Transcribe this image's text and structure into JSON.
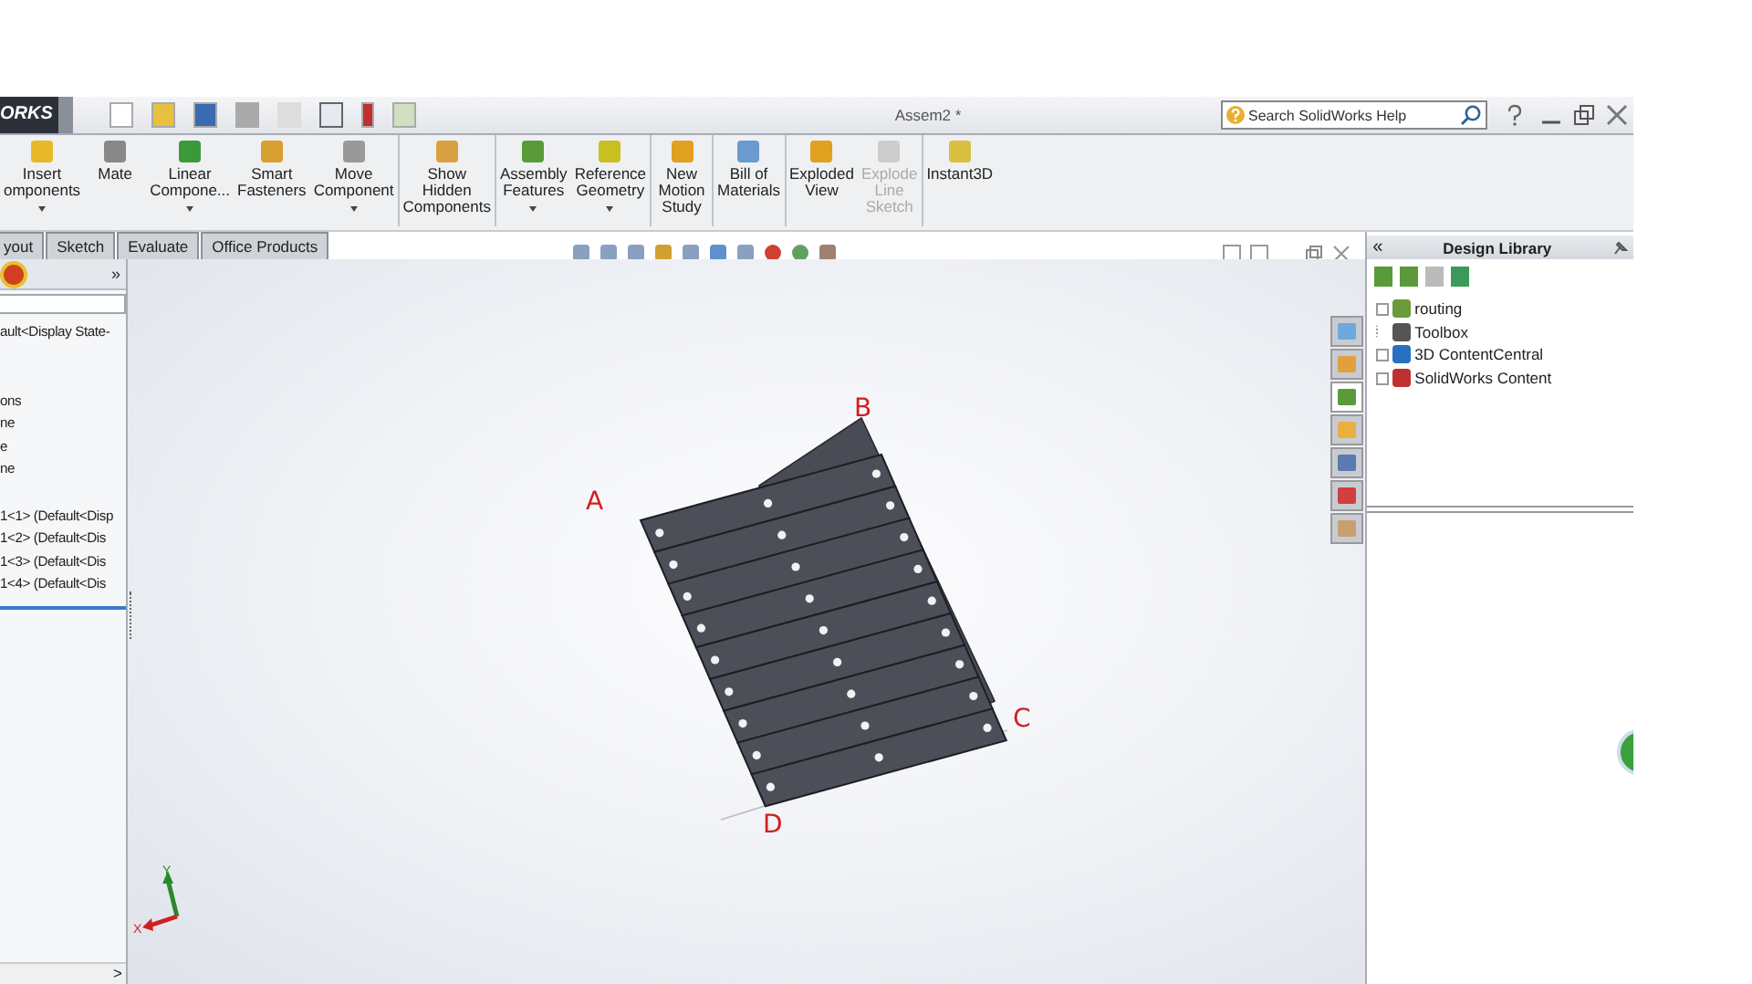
{
  "title_bar": {
    "logo": "ORKS",
    "title": "Assem2 *",
    "search": {
      "placeholder": "Search SolidWorks Help"
    }
  },
  "ribbon": [
    {
      "lines": [
        "Insert",
        "omponents"
      ],
      "dropdown": true,
      "disabled": false
    },
    {
      "lines": [
        "Mate"
      ],
      "dropdown": false,
      "disabled": false
    },
    {
      "lines": [
        "Linear",
        "Compone..."
      ],
      "dropdown": true,
      "disabled": false
    },
    {
      "lines": [
        "Smart",
        "Fasteners"
      ],
      "dropdown": false,
      "disabled": false
    },
    {
      "lines": [
        "Move",
        "Component"
      ],
      "dropdown": true,
      "disabled": false
    },
    {
      "lines": [
        "Show",
        "Hidden",
        "Components"
      ],
      "dropdown": false,
      "disabled": false
    },
    {
      "lines": [
        "Assembly",
        "Features"
      ],
      "dropdown": true,
      "disabled": false
    },
    {
      "lines": [
        "Reference",
        "Geometry"
      ],
      "dropdown": true,
      "disabled": false
    },
    {
      "lines": [
        "New",
        "Motion",
        "Study"
      ],
      "dropdown": false,
      "disabled": false
    },
    {
      "lines": [
        "Bill of",
        "Materials"
      ],
      "dropdown": false,
      "disabled": false
    },
    {
      "lines": [
        "Exploded",
        "View"
      ],
      "dropdown": false,
      "disabled": false
    },
    {
      "lines": [
        "Explode",
        "Line",
        "Sketch"
      ],
      "dropdown": false,
      "disabled": true
    },
    {
      "lines": [
        "Instant3D"
      ],
      "dropdown": false,
      "disabled": false
    }
  ],
  "tabs": [
    {
      "label": "yout"
    },
    {
      "label": "Sketch"
    },
    {
      "label": "Evaluate"
    },
    {
      "label": "Office Products"
    }
  ],
  "feature_tree": {
    "expand_label": "»",
    "groups": [
      [
        "ault<Display State-"
      ],
      [
        "ons",
        "ne",
        "e",
        "ne"
      ],
      [
        "1<1> (Default<Disp",
        "1<2> (Default<Dis",
        "1<3> (Default<Dis",
        "1<4> (Default<Dis"
      ]
    ],
    "scroll_label": ">"
  },
  "task_pane_tabs": [
    {
      "selected": false
    },
    {
      "selected": false
    },
    {
      "selected": true
    },
    {
      "selected": false
    },
    {
      "selected": false
    },
    {
      "selected": false
    },
    {
      "selected": false
    }
  ],
  "viewport": {
    "labels": [
      "A",
      "B",
      "C",
      "D"
    ],
    "triad": {
      "x": "X",
      "y": "Y"
    }
  },
  "design_library": {
    "collapse_label": "«",
    "title": "Design Library",
    "items": [
      {
        "label": "routing",
        "has_children": true
      },
      {
        "label": "Toolbox",
        "has_children": false
      },
      {
        "label": "3D ContentCentral",
        "has_children": true
      },
      {
        "label": "SolidWorks Content",
        "has_children": true
      }
    ]
  }
}
